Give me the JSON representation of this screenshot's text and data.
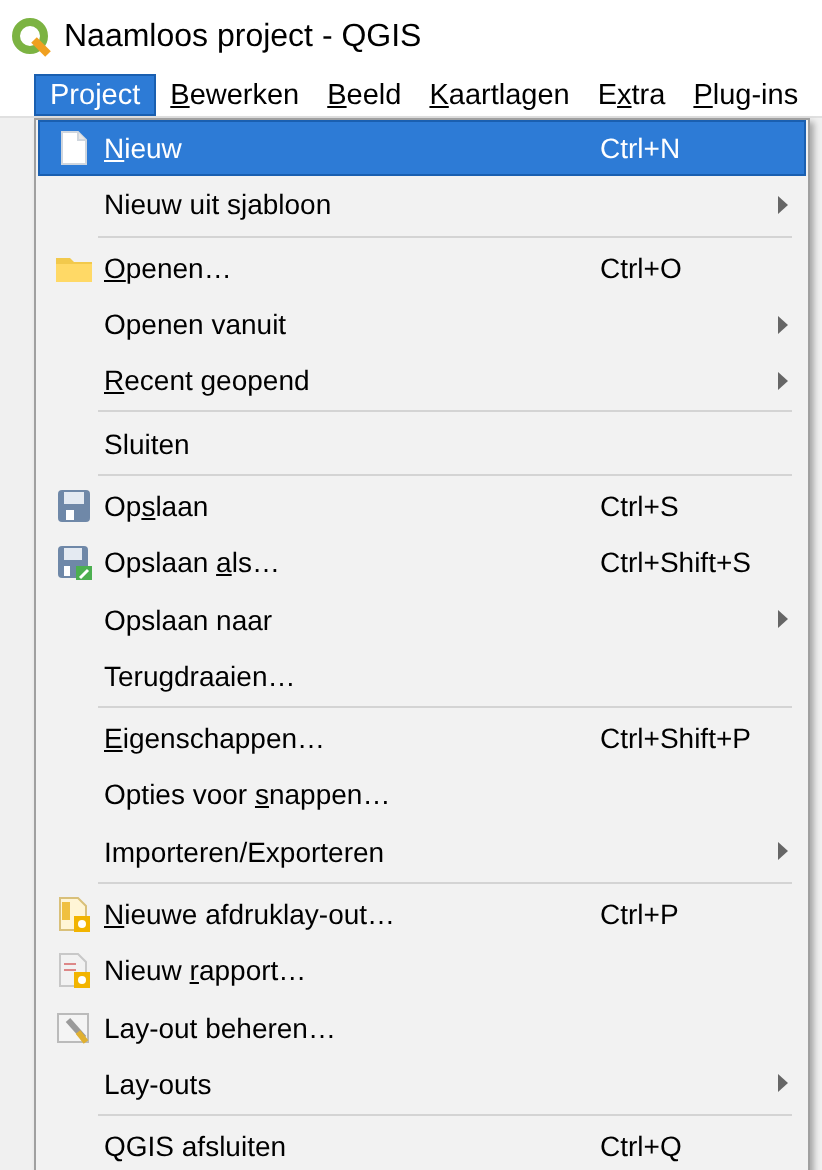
{
  "window": {
    "title": "Naamloos project - QGIS"
  },
  "menubar": [
    {
      "label": "Project",
      "selected": true
    },
    {
      "label": "Bewerken",
      "selected": false
    },
    {
      "label": "Beeld",
      "selected": false
    },
    {
      "label": "Kaartlagen",
      "selected": false
    },
    {
      "label": "Extra",
      "selected": false
    },
    {
      "label": "Plug-ins",
      "selected": false
    }
  ],
  "menu": [
    {
      "kind": "item",
      "label": "Nieuw",
      "shortcut": "Ctrl+N",
      "highlighted": true,
      "submenu": false
    },
    {
      "kind": "item",
      "label": "Nieuw uit sjabloon",
      "highlighted": false,
      "submenu": true
    },
    {
      "kind": "separator"
    },
    {
      "kind": "item",
      "label": "Openen…",
      "shortcut": "Ctrl+O",
      "highlighted": false,
      "submenu": false
    },
    {
      "kind": "item",
      "label": "Openen vanuit",
      "highlighted": false,
      "submenu": true
    },
    {
      "kind": "item",
      "label": "Recent geopend",
      "highlighted": false,
      "submenu": true
    },
    {
      "kind": "separator"
    },
    {
      "kind": "item",
      "label": "Sluiten",
      "highlighted": false,
      "submenu": false
    },
    {
      "kind": "separator"
    },
    {
      "kind": "item",
      "label": "Opslaan",
      "shortcut": "Ctrl+S",
      "highlighted": false,
      "submenu": false
    },
    {
      "kind": "item",
      "label": "Opslaan als…",
      "shortcut": "Ctrl+Shift+S",
      "highlighted": false,
      "submenu": false
    },
    {
      "kind": "item",
      "label": "Opslaan naar",
      "highlighted": false,
      "submenu": true
    },
    {
      "kind": "item",
      "label": "Terugdraaien…",
      "highlighted": false,
      "submenu": false
    },
    {
      "kind": "separator"
    },
    {
      "kind": "item",
      "label": "Eigenschappen…",
      "shortcut": "Ctrl+Shift+P",
      "highlighted": false,
      "submenu": false
    },
    {
      "kind": "item",
      "label": "Opties voor snappen…",
      "highlighted": false,
      "submenu": false
    },
    {
      "kind": "item",
      "label": "Importeren/Exporteren",
      "highlighted": false,
      "submenu": true
    },
    {
      "kind": "separator"
    },
    {
      "kind": "item",
      "label": "Nieuwe afdruklay-out…",
      "shortcut": "Ctrl+P",
      "highlighted": false,
      "submenu": false
    },
    {
      "kind": "item",
      "label": "Nieuw rapport…",
      "highlighted": false,
      "submenu": false
    },
    {
      "kind": "item",
      "label": "Lay-out beheren…",
      "highlighted": false,
      "submenu": false
    },
    {
      "kind": "item",
      "label": "Lay-outs",
      "highlighted": false,
      "submenu": true
    },
    {
      "kind": "separator"
    },
    {
      "kind": "item",
      "label": "QGIS afsluiten",
      "shortcut": "Ctrl+Q",
      "highlighted": false,
      "submenu": false
    }
  ]
}
